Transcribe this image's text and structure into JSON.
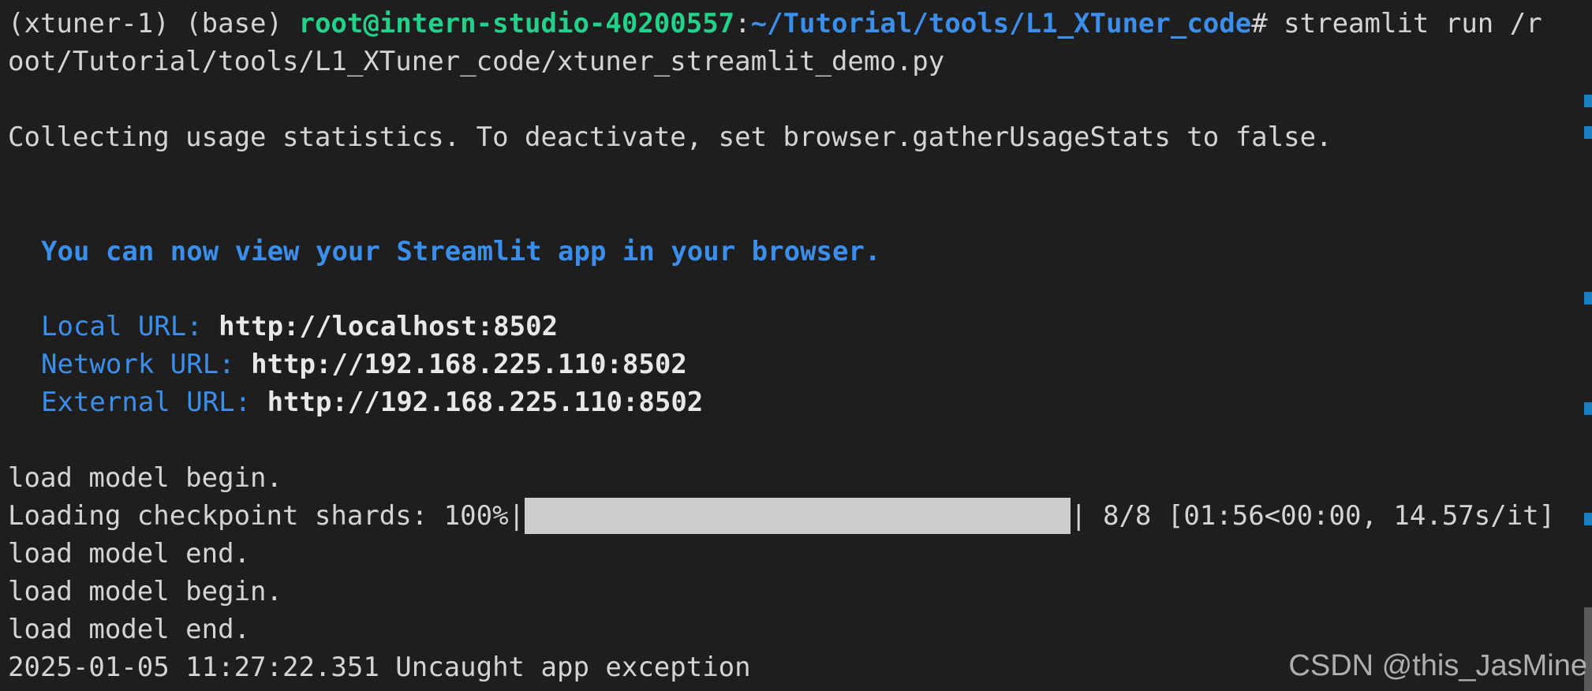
{
  "prompt": {
    "env": "(xtuner-1) (base) ",
    "user_host": "root@intern-studio-40200557",
    "sep": ":",
    "path": "~/Tutorial/tools/L1_XTuner_code",
    "symbol": "# ",
    "command": "streamlit run /r",
    "command_wrap": "oot/Tutorial/tools/L1_XTuner_code/xtuner_streamlit_demo.py"
  },
  "usage_stats": "Collecting usage statistics. To deactivate, set browser.gatherUsageStats to false.",
  "view_message": "You can now view your Streamlit app in your browser.",
  "urls": {
    "local_label": "Local URL: ",
    "local_value": "http://localhost:8502",
    "network_label": "Network URL: ",
    "network_value": "http://192.168.225.110:8502",
    "external_label": "External URL: ",
    "external_value": "http://192.168.225.110:8502"
  },
  "log": {
    "line1": "load model begin.",
    "progress_prefix": "Loading checkpoint shards: 100%|",
    "progress_suffix": "| 8/8 [01:56<00:00, 14.57s/it]",
    "progress_fraction": 1.0,
    "line3": "load model end.",
    "line4": "load model begin.",
    "line5": "load model end.",
    "line6": "2025-01-05 11:27:22.351 Uncaught app exception"
  },
  "watermark": "CSDN @this_JasMine",
  "colors": {
    "background": "#1e1e1e",
    "text": "#d4d4d4",
    "green": "#23d18b",
    "blue": "#3b8eea",
    "progress": "#cccccc"
  }
}
